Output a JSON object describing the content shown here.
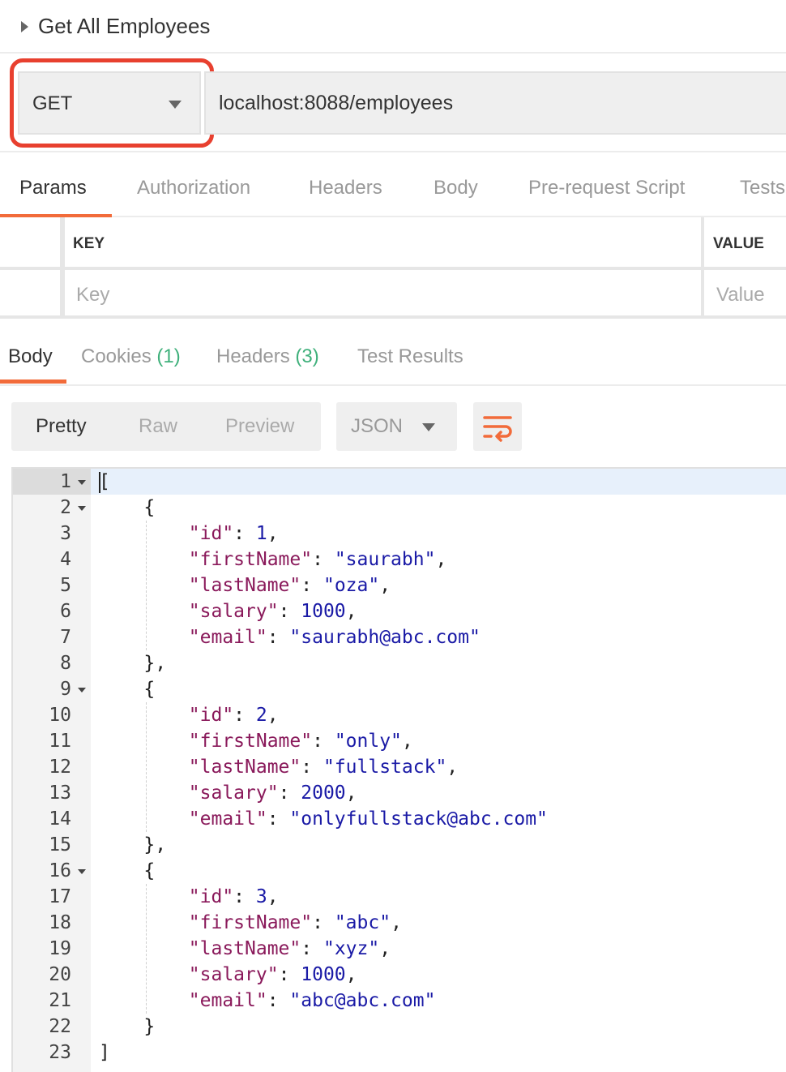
{
  "request": {
    "title": "Get All Employees",
    "method": "GET",
    "url": "localhost:8088/employees"
  },
  "request_tabs": [
    "Params",
    "Authorization",
    "Headers",
    "Body",
    "Pre-request Script",
    "Tests"
  ],
  "params_table": {
    "key_header": "KEY",
    "value_header": "VALUE",
    "key_placeholder": "Key",
    "value_placeholder": "Value"
  },
  "response_tabs": {
    "body": "Body",
    "cookies": "Cookies",
    "cookies_count": "(1)",
    "headers": "Headers",
    "headers_count": "(3)",
    "test_results": "Test Results"
  },
  "toolbar": {
    "pretty": "Pretty",
    "raw": "Raw",
    "preview": "Preview",
    "format": "JSON",
    "wrap_icon": "wrap-lines-icon"
  },
  "accent_colors": {
    "tab_underline": "#f26b3a",
    "highlight": "#e8402f",
    "count": "#3fb07b"
  },
  "response_lines": [
    "[",
    "    {",
    "        \"id\": 1,",
    "        \"firstName\": \"saurabh\",",
    "        \"lastName\": \"oza\",",
    "        \"salary\": 1000,",
    "        \"email\": \"saurabh@abc.com\"",
    "    },",
    "    {",
    "        \"id\": 2,",
    "        \"firstName\": \"only\",",
    "        \"lastName\": \"fullstack\",",
    "        \"salary\": 2000,",
    "        \"email\": \"onlyfullstack@abc.com\"",
    "    },",
    "    {",
    "        \"id\": 3,",
    "        \"firstName\": \"abc\",",
    "        \"lastName\": \"xyz\",",
    "        \"salary\": 1000,",
    "        \"email\": \"abc@abc.com\"",
    "    }",
    "]"
  ]
}
